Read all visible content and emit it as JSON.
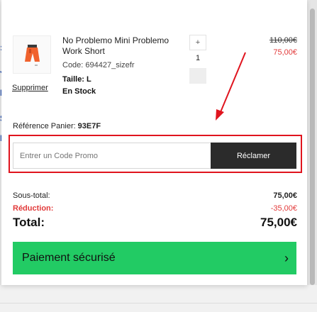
{
  "product": {
    "name": "No Problemo Mini Problemo Work Short",
    "code": "Code: 694427_sizefr",
    "size": "Taille: L",
    "stock": "En Stock",
    "remove_label": "Supprimer",
    "quantity": "1",
    "plus_label": "+",
    "price_original": "110,00€",
    "price_discounted": "75,00€"
  },
  "cart": {
    "reference_label": "Référence Panier:",
    "reference_value": "93E7F"
  },
  "promo": {
    "placeholder": "Entrer un Code Promo",
    "button_label": "Réclamer"
  },
  "summary": {
    "subtotal_label": "Sous-total:",
    "subtotal_value": "75,00€",
    "discount_label": "Réduction:",
    "discount_value": "-35,00€",
    "total_label": "Total:",
    "total_value": "75,00€"
  },
  "checkout": {
    "button_label": "Paiement sécurisé",
    "chevron": "›"
  },
  "colors": {
    "accent_red": "#e0141e",
    "price_red": "#e23b3b",
    "checkout_green": "#22cb64",
    "button_dark": "#2b2b2b"
  }
}
